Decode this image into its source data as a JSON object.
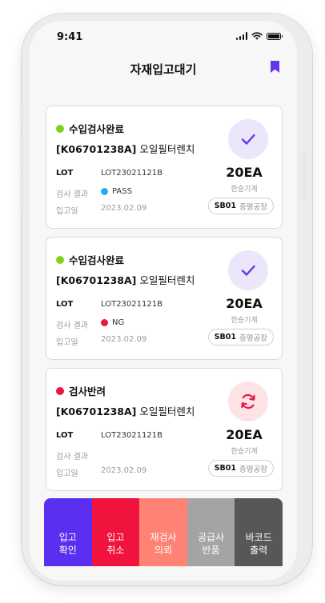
{
  "status_bar": {
    "time": "9:41"
  },
  "header": {
    "title": "자재입고대기"
  },
  "colors": {
    "accent": "#6138e8",
    "pass_green": "#7ed321",
    "reject_red": "#e8173e",
    "pass_blue": "#2aa8f2",
    "check_badge_bg": "#ece6fb",
    "reject_badge_bg": "#fde2e6"
  },
  "cards": [
    {
      "status": "수입검사완료",
      "status_color": "#7ed321",
      "code": "[K06701238A]",
      "name": "오일필터렌치",
      "lot_label": "LOT",
      "lot_value": "LOT23021121B",
      "result_label": "검사 결과",
      "result_value": "PASS",
      "result_color": "#2aa8f2",
      "date_label": "입고일",
      "date_value": "2023.02.09",
      "icon": "check-icon",
      "quantity": "20EA",
      "vendor": "한승기계",
      "plant_code": "SB01",
      "plant_name": "증평공장"
    },
    {
      "status": "수입검사완료",
      "status_color": "#7ed321",
      "code": "[K06701238A]",
      "name": "오일필터렌치",
      "lot_label": "LOT",
      "lot_value": "LOT23021121B",
      "result_label": "검사 결과",
      "result_value": "NG",
      "result_color": "#e8173e",
      "date_label": "입고일",
      "date_value": "2023.02.09",
      "icon": "check-icon",
      "quantity": "20EA",
      "vendor": "한승기계",
      "plant_code": "SB01",
      "plant_name": "증평공장"
    },
    {
      "status": "검사반려",
      "status_color": "#e8173e",
      "code": "[K06701238A]",
      "name": "오일필터렌치",
      "lot_label": "LOT",
      "lot_value": "LOT23021121B",
      "result_label": "검사 결과",
      "result_value": "",
      "date_label": "입고일",
      "date_value": "2023.02.09",
      "icon": "refresh-icon",
      "quantity": "20EA",
      "vendor": "한승기계",
      "plant_code": "SB01",
      "plant_name": "증평공장"
    }
  ],
  "actions": [
    {
      "label": "입고\n확인",
      "color": "#5a2ff0"
    },
    {
      "label": "입고\n취소",
      "color": "#f0133e"
    },
    {
      "label": "재검사\n의뢰",
      "color": "#ff8374"
    },
    {
      "label": "공급사\n반품",
      "color": "#a6a3a3"
    },
    {
      "label": "바코드\n출력",
      "color": "#575757"
    }
  ]
}
